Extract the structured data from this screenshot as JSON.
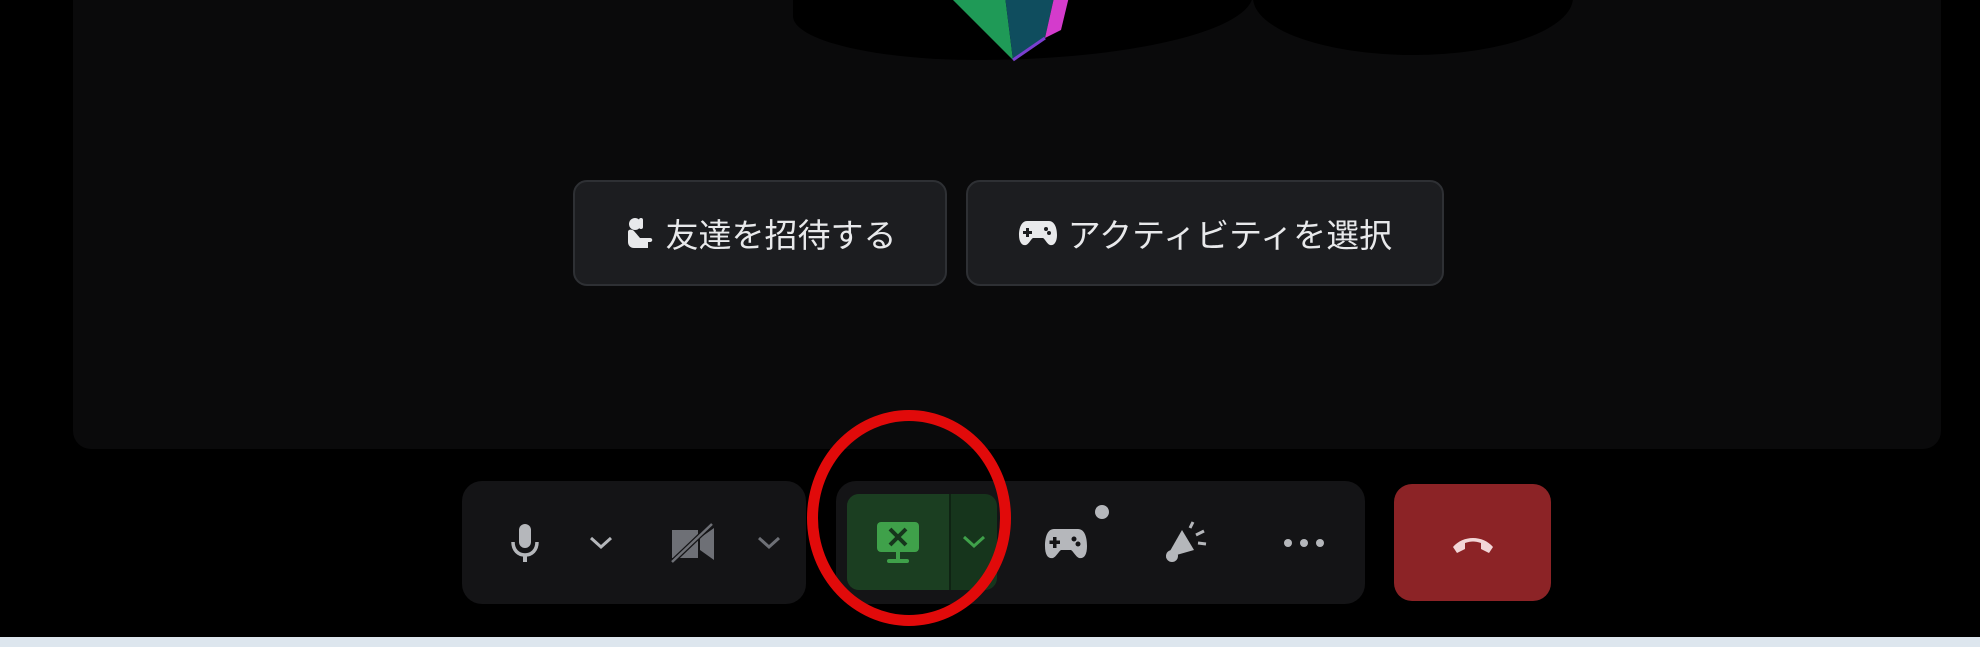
{
  "stage": {
    "invite_button_label": "友達を招待する",
    "activity_button_label": "アクティビティを選択"
  },
  "controls": {
    "microphone_icon": "microphone-icon",
    "camera_icon": "camera-off-icon",
    "screen_share_icon": "screen-share-stop-icon",
    "activity_icon": "gamepad-icon",
    "soundboard_icon": "soundboard-icon",
    "more_icon": "ellipsis-icon",
    "end_call_icon": "phone-hangup-icon"
  },
  "colors": {
    "stage_background": "#0a0a0b",
    "screen_share_active": "#3fa14a",
    "end_call_red": "#8c2326",
    "highlight_ring": "#e10a0a"
  }
}
